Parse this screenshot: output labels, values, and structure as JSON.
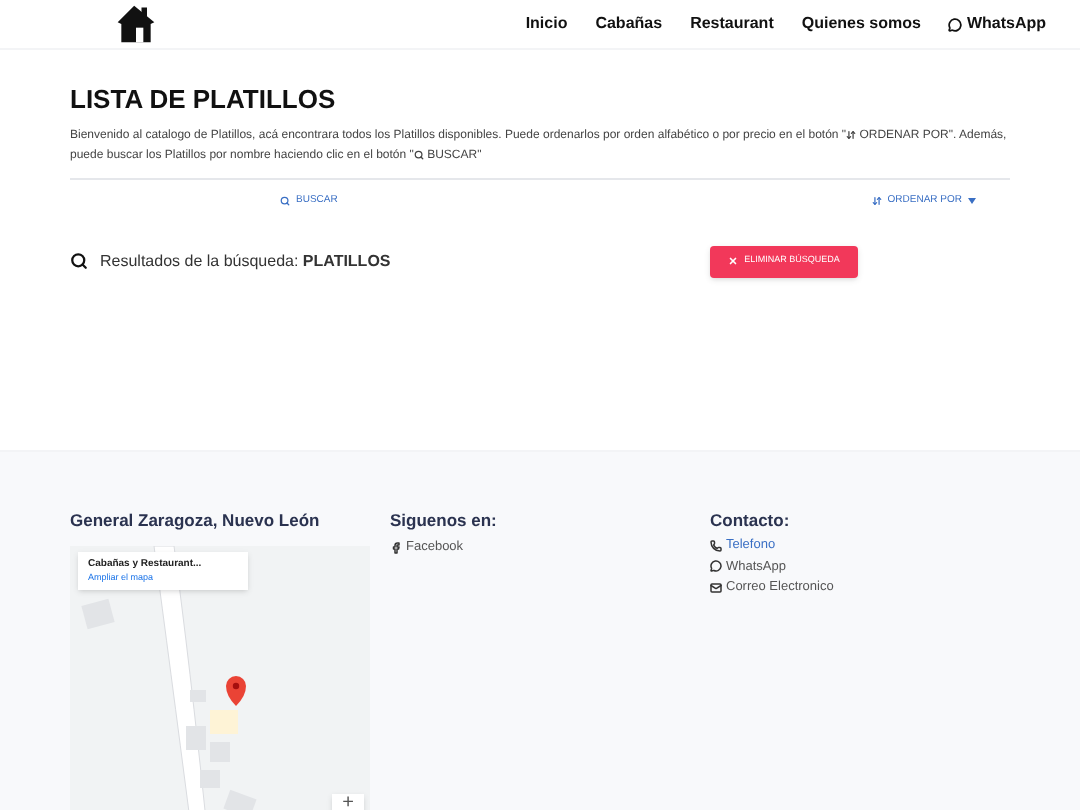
{
  "nav": {
    "items": [
      "Inicio",
      "Cabañas",
      "Restaurant",
      "Quienes somos",
      "WhatsApp"
    ]
  },
  "header": {
    "title": "LISTA DE PLATILLOS",
    "intro_1": "Bienvenido al catalogo de Platillos, acá encontrara todos los Platillos disponibles. Puede ordenarlos por orden alfabético o por precio en el botón \"",
    "intro_sort": "ORDENAR POR\". Además, puede buscar los Platillos por nombre haciendo clic en el botón \"",
    "intro_search": "BUSCAR\""
  },
  "toolbar": {
    "search": "BUSCAR",
    "sort": "ORDENAR POR"
  },
  "results": {
    "label": "Resultados de la búsqueda: **PLATILLOS**",
    "clear": "ELIMINAR BÚSQUEDA"
  },
  "footer": {
    "location": {
      "title": "General Zaragoza, Nuevo León",
      "map_card_title": "Cabañas y Restaurant...",
      "map_card_link": "Ampliar el mapa",
      "zoom_in": "+"
    },
    "social": {
      "title": "Siguenos en:",
      "links": [
        "Facebook"
      ]
    },
    "contact": {
      "title": "Contacto:",
      "links": [
        {
          "kind": "phone",
          "text": "Telefono"
        },
        {
          "kind": "whatsapp",
          "text": "WhatsApp"
        },
        {
          "kind": "email",
          "text": "Correo Electronico"
        }
      ]
    }
  }
}
